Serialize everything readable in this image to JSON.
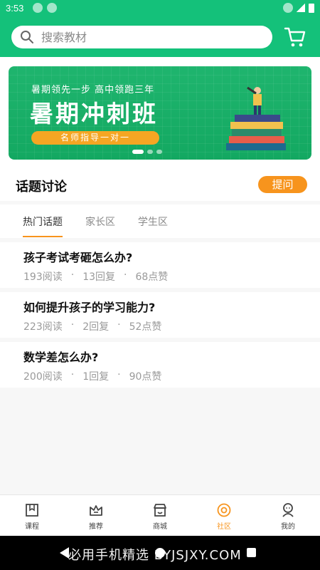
{
  "status_bar": {
    "time": "3:53"
  },
  "search": {
    "placeholder": "搜索教材"
  },
  "banner": {
    "subtitle": "暑期领先一步 高中领跑三年",
    "title": "暑期冲刺班",
    "pill": "名师指导一对一",
    "active_slide": 1,
    "slide_count": 3
  },
  "topics": {
    "heading": "话题讨论",
    "ask_label": "提问"
  },
  "tabs": [
    {
      "label": "热门话题",
      "active": true
    },
    {
      "label": "家长区",
      "active": false
    },
    {
      "label": "学生区",
      "active": false
    }
  ],
  "posts": [
    {
      "title": "孩子考试考砸怎么办?",
      "reads": "193阅读",
      "replies": "13回复",
      "likes": "68点赞"
    },
    {
      "title": "如何提升孩子的学习能力?",
      "reads": "223阅读",
      "replies": "2回复",
      "likes": "52点赞"
    },
    {
      "title": "数学差怎么办?",
      "reads": "200阅读",
      "replies": "1回复",
      "likes": "90点赞"
    }
  ],
  "meta_separator": "·",
  "bottom_nav": [
    {
      "label": "课程",
      "icon": "course-icon",
      "active": false
    },
    {
      "label": "推荐",
      "icon": "crown-icon",
      "active": false
    },
    {
      "label": "商城",
      "icon": "store-icon",
      "active": false
    },
    {
      "label": "社区",
      "icon": "community-icon",
      "active": true
    },
    {
      "label": "我的",
      "icon": "profile-icon",
      "active": false
    }
  ],
  "watermark": "必用手机精选 BYJSJXY.COM",
  "colors": {
    "brand_green": "#14c17a",
    "accent_orange": "#f7941d"
  }
}
